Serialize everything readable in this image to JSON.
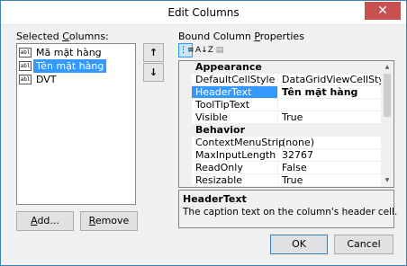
{
  "window": {
    "title": "Edit Columns",
    "close_glyph": "✕"
  },
  "left": {
    "label_prefix": "Selected ",
    "label_hotkey": "C",
    "label_suffix": "olumns:",
    "items": [
      {
        "icon": "abl",
        "label": "Mã mặt hàng",
        "selected": false
      },
      {
        "icon": "abl",
        "label": "Tên mặt hàng",
        "selected": true
      },
      {
        "icon": "abl",
        "label": "DVT",
        "selected": false
      }
    ],
    "move_up_glyph": "↑",
    "move_down_glyph": "↓",
    "add_hotkey": "A",
    "add_rest": "dd...",
    "remove_hotkey": "R",
    "remove_rest": "emove"
  },
  "right": {
    "label_prefix": "Bound Column ",
    "label_hotkey": "P",
    "label_suffix": "roperties",
    "toolbar": {
      "categorized": "⋮≡",
      "alphabetical": "A↓Z",
      "pages": "▤"
    },
    "grid": [
      {
        "type": "category",
        "name": "Appearance"
      },
      {
        "type": "prop",
        "name": "DefaultCellStyle",
        "value": "DataGridViewCellStyle { }"
      },
      {
        "type": "prop",
        "name": "HeaderText",
        "value": "Tên mặt hàng",
        "selected": true
      },
      {
        "type": "prop",
        "name": "ToolTipText",
        "value": ""
      },
      {
        "type": "prop",
        "name": "Visible",
        "value": "True"
      },
      {
        "type": "category",
        "name": "Behavior"
      },
      {
        "type": "prop",
        "name": "ContextMenuStrip",
        "value": "(none)"
      },
      {
        "type": "prop",
        "name": "MaxInputLength",
        "value": "32767"
      },
      {
        "type": "prop",
        "name": "ReadOnly",
        "value": "False"
      },
      {
        "type": "prop",
        "name": "Resizable",
        "value": "True"
      }
    ],
    "help": {
      "title": "HeaderText",
      "description": "The caption text on the column's header cell."
    }
  },
  "buttons": {
    "ok": "OK",
    "cancel": "Cancel"
  }
}
